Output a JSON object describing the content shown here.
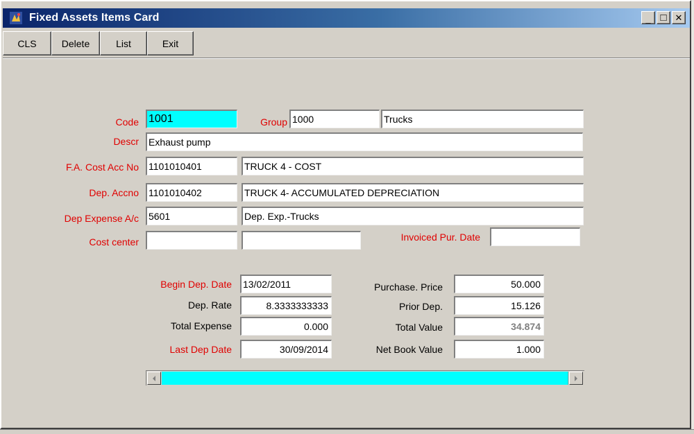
{
  "window": {
    "title": "Fixed Assets Items Card",
    "minimize": "_",
    "maximize": "□",
    "close": "✕"
  },
  "toolbar": {
    "cls_label": "CLS",
    "delete_label": "Delete",
    "list_label": "List",
    "exit_label": "Exit"
  },
  "form": {
    "code_label": "Code",
    "code_value": "1001",
    "group_label": "Group",
    "group_code": "1000",
    "group_name": "Trucks",
    "descr_label": "Descr",
    "descr_value": "Exhaust pump",
    "cost_acc_label": "F.A. Cost Acc No",
    "cost_acc_no": "1101010401",
    "cost_acc_name": "TRUCK 4 - COST",
    "dep_acc_label": "Dep. Accno",
    "dep_acc_no": "1101010402",
    "dep_acc_name": "TRUCK 4- ACCUMULATED DEPRECIATION",
    "dep_exp_label": "Dep Expense A/c",
    "dep_exp_no": "5601",
    "dep_exp_name": "Dep. Exp.-Trucks",
    "cost_center_label": "Cost center",
    "cost_center_code": "",
    "cost_center_name": "",
    "invoiced_label": "Invoiced Pur. Date",
    "invoiced_value": "",
    "begin_dep_label": "Begin Dep. Date",
    "begin_dep_value": "13/02/2011",
    "dep_rate_label": "Dep. Rate",
    "dep_rate_value": "8.3333333333",
    "total_expense_label": "Total Expense",
    "total_expense_value": "0.000",
    "last_dep_label": "Last Dep Date",
    "last_dep_value": "30/09/2014",
    "purchase_price_label": "Purchase. Price",
    "purchase_price_value": "50.000",
    "prior_dep_label": "Prior Dep.",
    "prior_dep_value": "15.126",
    "total_value_label": "Total Value",
    "total_value_value": "34.874",
    "net_book_label": "Net Book Value",
    "net_book_value": "1.000"
  },
  "colors": {
    "label_red": "#e00000",
    "highlight_cyan": "#00ffff",
    "title_gradient_start": "#0a246a"
  }
}
